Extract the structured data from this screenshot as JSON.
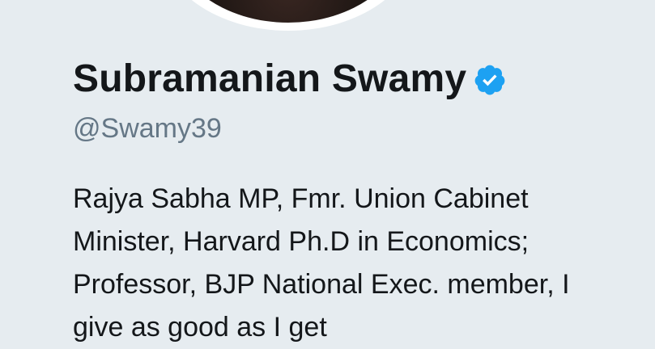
{
  "profile": {
    "name": "Subramanian Swamy",
    "handle": "@Swamy39",
    "bio_lines": [
      "Rajya Sabha MP, Fmr. Union Cabinet",
      "Minister, Harvard Ph.D in Economics;",
      "Professor, BJP National Exec. member, I",
      "give as good as I get"
    ],
    "verified_icon": "verified-badge-icon"
  },
  "colors": {
    "background": "#e6ecf0",
    "name": "#14171a",
    "handle": "#657786",
    "verified": "#1da1f2"
  }
}
